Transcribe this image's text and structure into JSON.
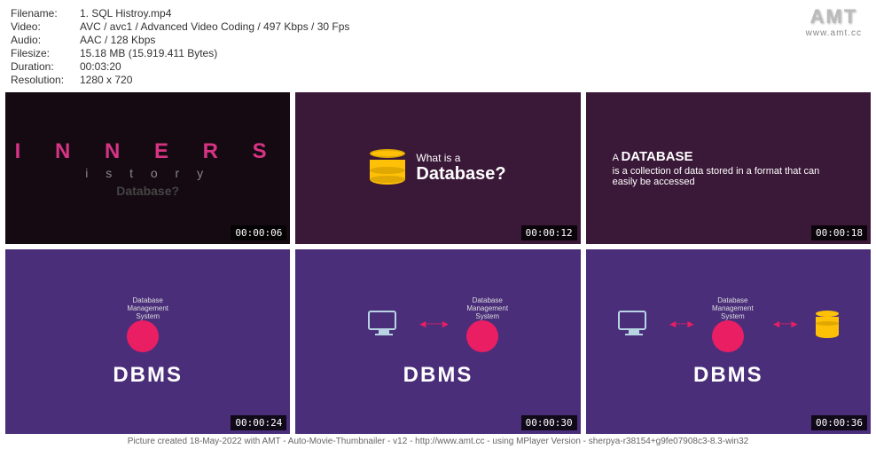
{
  "meta": {
    "filename_label": "Filename:",
    "filename": "1. SQL Histroy.mp4",
    "video_label": "Video:",
    "video": "AVC / avc1 / Advanced Video Coding / 497 Kbps / 30 Fps",
    "audio_label": "Audio:",
    "audio": "AAC / 128 Kbps",
    "filesize_label": "Filesize:",
    "filesize": "15.18 MB (15.919.411 Bytes)",
    "duration_label": "Duration:",
    "duration": "00:03:20",
    "resolution_label": "Resolution:",
    "resolution": "1280 x 720"
  },
  "logo": {
    "text": "AMT",
    "url": "www.amt.cc"
  },
  "thumbs": {
    "t1": {
      "letters": "I N N E R S",
      "sub": "i s t o r y",
      "db": "Database?",
      "ts": "00:00:06"
    },
    "t2": {
      "small": "What is a",
      "big": "Database?",
      "ts": "00:00:12"
    },
    "t3": {
      "prefix": "A",
      "bold": "DATABASE",
      "body": "is a collection of data stored in a format that can easily be accessed",
      "ts": "00:00:18"
    },
    "t4": {
      "label": "Database\nManagement\nSystem",
      "dbms": "DBMS",
      "ts": "00:00:24"
    },
    "t5": {
      "label": "Database\nManagement\nSystem",
      "dbms": "DBMS",
      "ts": "00:00:30"
    },
    "t6": {
      "label": "Database\nManagement\nSystem",
      "dbms": "DBMS",
      "ts": "00:00:36"
    }
  },
  "footer": "Picture created 18-May-2022 with AMT - Auto-Movie-Thumbnailer - v12 - http://www.amt.cc - using MPlayer Version - sherpya-r38154+g9fe07908c3-8.3-win32"
}
